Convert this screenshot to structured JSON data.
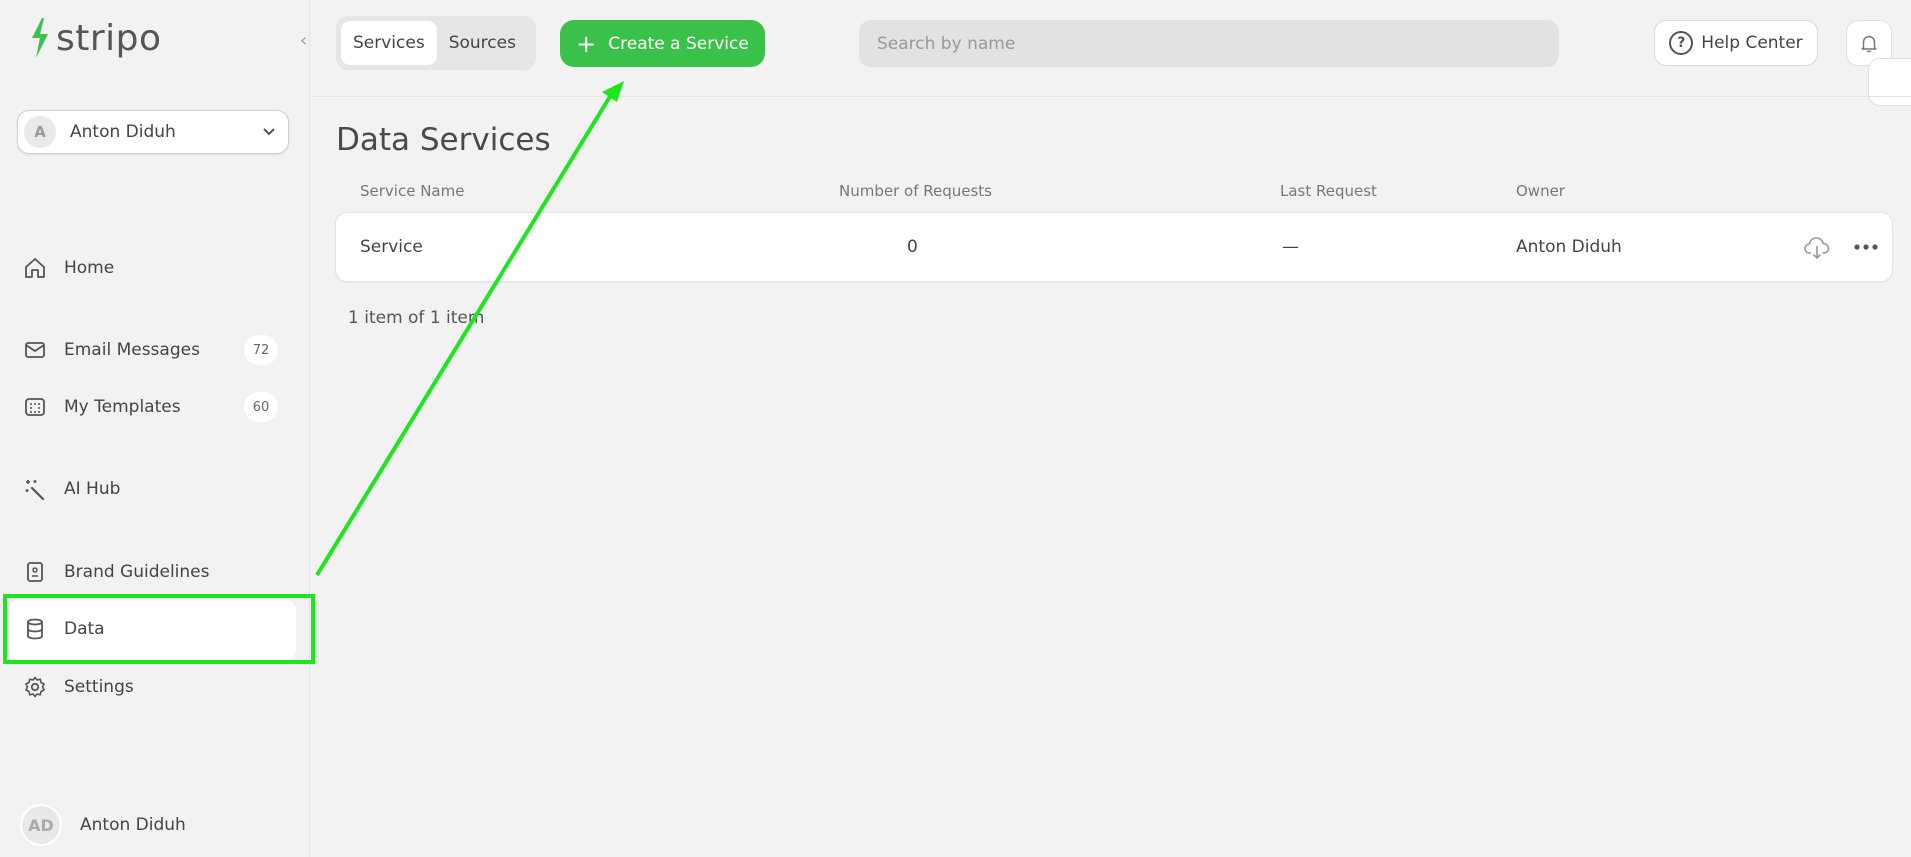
{
  "brand": {
    "name": "stripo",
    "accent_color": "#3ac14a"
  },
  "sidebar": {
    "account": {
      "initial": "A",
      "name": "Anton Diduh"
    },
    "items": [
      {
        "key": "home",
        "label": "Home",
        "icon": "home-icon"
      },
      {
        "key": "email-messages",
        "label": "Email Messages",
        "icon": "mail-icon",
        "badge": "72"
      },
      {
        "key": "my-templates",
        "label": "My Templates",
        "icon": "templates-icon",
        "badge": "60"
      },
      {
        "key": "ai-hub",
        "label": "AI Hub",
        "icon": "magic-wand-icon"
      },
      {
        "key": "brand-guidelines",
        "label": "Brand Guidelines",
        "icon": "book-icon"
      },
      {
        "key": "data",
        "label": "Data",
        "icon": "database-icon",
        "active": true
      },
      {
        "key": "settings",
        "label": "Settings",
        "icon": "gear-icon"
      }
    ],
    "user": {
      "initials": "AD",
      "name": "Anton Diduh"
    }
  },
  "header": {
    "tabs": [
      {
        "label": "Services",
        "active": true
      },
      {
        "label": "Sources",
        "active": false
      }
    ],
    "create_label": "Create a Service",
    "search_placeholder": "Search by name",
    "help_label": "Help Center"
  },
  "main": {
    "title": "Data Services",
    "columns": [
      "Service Name",
      "Number of Requests",
      "Last Request",
      "Owner"
    ],
    "rows": [
      {
        "service_name": "Service",
        "requests": "0",
        "last_request": "—",
        "owner": "Anton Diduh"
      }
    ],
    "pagination": "1 item of 1 item"
  },
  "annotation": {
    "highlight_color": "#1fe51f"
  }
}
